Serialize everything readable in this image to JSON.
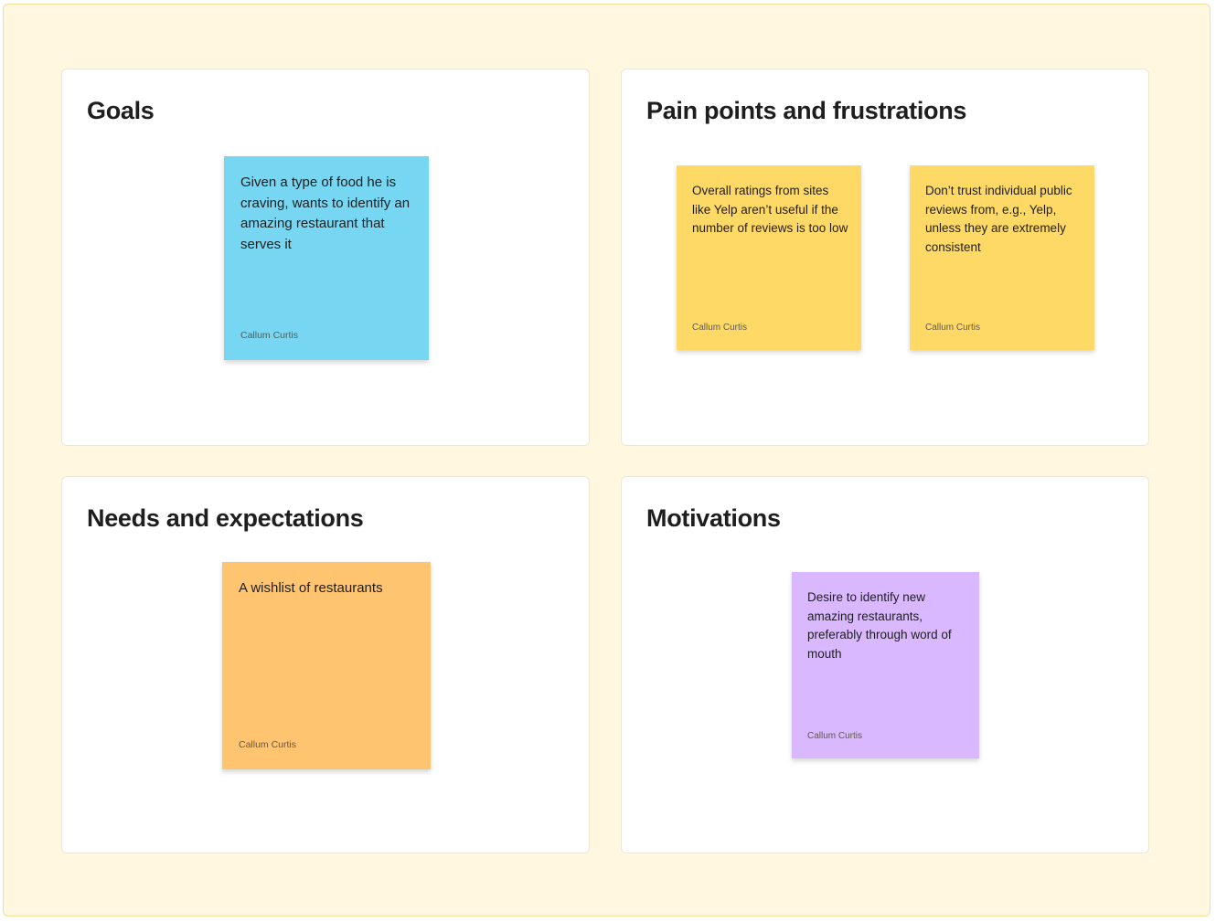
{
  "colors": {
    "board_bg": "#fff7df",
    "sticky_blue": "#77d7f2",
    "sticky_yellow": "#ffd966",
    "sticky_orange": "#ffc470",
    "sticky_purple": "#d9b8ff"
  },
  "sections": {
    "goals": {
      "title": "Goals",
      "stickies": [
        {
          "text": "Given a type of food he is craving, wants to identify an amazing restaurant that serves it",
          "author": "Callum Curtis",
          "color": "#77d7f2"
        }
      ]
    },
    "pain_points": {
      "title": "Pain points and frustrations",
      "stickies": [
        {
          "text": "Overall ratings from sites like Yelp aren’t useful if the number of reviews is too low",
          "author": "Callum Curtis",
          "color": "#ffd966"
        },
        {
          "text": "Don’t trust individual public reviews from, e.g., Yelp, unless they are extremely consistent",
          "author": "Callum Curtis",
          "color": "#ffd966"
        }
      ]
    },
    "needs": {
      "title": "Needs and expectations",
      "stickies": [
        {
          "text": "A wishlist of restaurants",
          "author": "Callum Curtis",
          "color": "#ffc470"
        }
      ]
    },
    "motivations": {
      "title": "Motivations",
      "stickies": [
        {
          "text": "Desire to identify new amazing restaurants, preferably through word of mouth",
          "author": "Callum Curtis",
          "color": "#d9b8ff"
        }
      ]
    }
  }
}
